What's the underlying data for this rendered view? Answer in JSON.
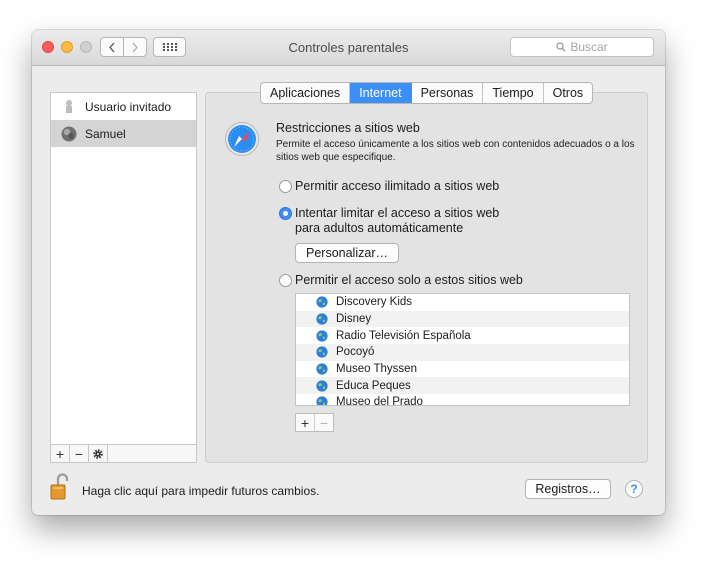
{
  "window": {
    "title": "Controles parentales"
  },
  "search": {
    "placeholder": "Buscar"
  },
  "users": [
    {
      "label": "Usuario invitado",
      "icon": "guest-user-icon"
    },
    {
      "label": "Samuel",
      "icon": "user-avatar-icon",
      "selected": true
    }
  ],
  "tabs": [
    {
      "label": "Aplicaciones"
    },
    {
      "label": "Internet",
      "active": true
    },
    {
      "label": "Personas"
    },
    {
      "label": "Tiempo"
    },
    {
      "label": "Otros"
    }
  ],
  "internet": {
    "heading": "Restricciones a sitios web",
    "description": "Permite el acceso únicamente a los sitios web con contenidos adecuados o a los sitios web que especifique.",
    "options": {
      "unlimited": "Permitir acceso ilimitado a sitios web",
      "limit_line1": "Intentar limitar el acceso a sitios web",
      "limit_line2": "para adultos automáticamente",
      "only": "Permitir el acceso solo a estos sitios web"
    },
    "selected_option": "limit",
    "customize_label": "Personalizar…",
    "sites": [
      "Discovery Kids",
      "Disney",
      "Radio Televisión Española",
      "Pocoyó",
      "Museo Thyssen",
      "Educa Peques",
      "Museo del Prado"
    ]
  },
  "footer": {
    "lock_text": "Haga clic aquí para impedir futuros cambios.",
    "logs_label": "Registros…",
    "help_label": "?"
  },
  "tools": {
    "add": "+",
    "remove": "−"
  },
  "colors": {
    "accent": "#3e8ef7",
    "close": "#fc605c",
    "minimize": "#fdbc40"
  }
}
